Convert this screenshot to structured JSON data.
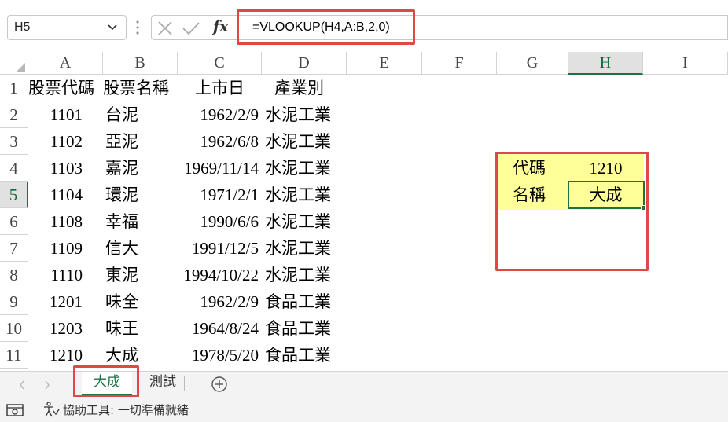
{
  "formula_bar": {
    "name_box": "H5",
    "formula": "=VLOOKUP(H4,A:B,2,0)",
    "fx_label": "fx"
  },
  "grid": {
    "columns": [
      "A",
      "B",
      "C",
      "D",
      "E",
      "F",
      "G",
      "H",
      "I"
    ],
    "rows": [
      "1",
      "2",
      "3",
      "4",
      "5",
      "6",
      "7",
      "8",
      "9",
      "10",
      "11"
    ],
    "selected_column": "H",
    "selected_row": "5",
    "data": [
      {
        "a": "股票代碼",
        "b": "股票名稱",
        "c": "上市日",
        "d": "產業別"
      },
      {
        "a": "1101",
        "b": "台泥",
        "c": "1962/2/9",
        "d": "水泥工業"
      },
      {
        "a": "1102",
        "b": "亞泥",
        "c": "1962/6/8",
        "d": "水泥工業"
      },
      {
        "a": "1103",
        "b": "嘉泥",
        "c": "1969/11/14",
        "d": "水泥工業"
      },
      {
        "a": "1104",
        "b": "環泥",
        "c": "1971/2/1",
        "d": "水泥工業"
      },
      {
        "a": "1108",
        "b": "幸福",
        "c": "1990/6/6",
        "d": "水泥工業"
      },
      {
        "a": "1109",
        "b": "信大",
        "c": "1991/12/5",
        "d": "水泥工業"
      },
      {
        "a": "1110",
        "b": "東泥",
        "c": "1994/10/22",
        "d": "水泥工業"
      },
      {
        "a": "1201",
        "b": "味全",
        "c": "1962/2/9",
        "d": "食品工業"
      },
      {
        "a": "1203",
        "b": "味王",
        "c": "1964/8/24",
        "d": "食品工業"
      },
      {
        "a": "1210",
        "b": "大成",
        "c": "1978/5/20",
        "d": "食品工業"
      }
    ],
    "lookup": {
      "code_label": "代碼",
      "code_value": "1210",
      "name_label": "名稱",
      "name_value": "大成"
    },
    "highlight_color": "#ffff99",
    "annotation_color": "#e04848",
    "accent_color": "#1e7145"
  },
  "sheet_tabs": {
    "active": "大成",
    "tabs": [
      "大成",
      "測試"
    ]
  },
  "status_bar": {
    "accessibility": "協助工具: 一切準備就緒"
  }
}
